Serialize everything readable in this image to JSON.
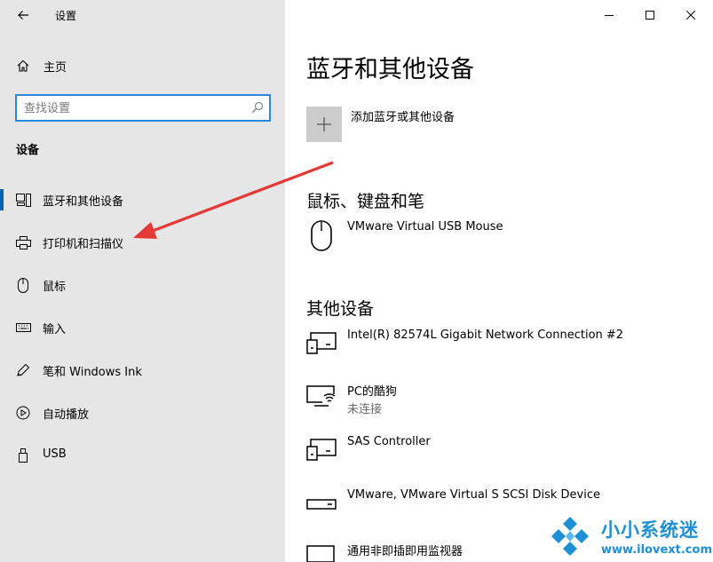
{
  "window": {
    "title": "设置"
  },
  "sidebar": {
    "home_label": "主页",
    "search_placeholder": "查找设置",
    "section_title": "设备",
    "items": [
      {
        "label": "蓝牙和其他设备",
        "icon": "bluetooth-devices-icon",
        "selected": true
      },
      {
        "label": "打印机和扫描仪",
        "icon": "printer-icon",
        "selected": false
      },
      {
        "label": "鼠标",
        "icon": "mouse-icon",
        "selected": false
      },
      {
        "label": "输入",
        "icon": "keyboard-icon",
        "selected": false
      },
      {
        "label": "笔和 Windows Ink",
        "icon": "pen-icon",
        "selected": false
      },
      {
        "label": "自动播放",
        "icon": "autoplay-icon",
        "selected": false
      },
      {
        "label": "USB",
        "icon": "usb-icon",
        "selected": false
      }
    ]
  },
  "main": {
    "title": "蓝牙和其他设备",
    "add_label": "添加蓝牙或其他设备",
    "mouse_section": {
      "title": "鼠标、键盘和笔",
      "devices": [
        {
          "name": "VMware Virtual USB Mouse",
          "icon": "mouse-icon"
        }
      ]
    },
    "other_section": {
      "title": "其他设备",
      "devices": [
        {
          "name": "Intel(R) 82574L Gigabit Network Connection #2",
          "status": "",
          "icon": "network-adapter-icon"
        },
        {
          "name": "PC的酷狗",
          "status": "未连接",
          "icon": "wireless-display-icon"
        },
        {
          "name": "SAS Controller",
          "status": "",
          "icon": "controller-icon"
        },
        {
          "name": "VMware, VMware Virtual S SCSI Disk Device",
          "status": "",
          "icon": "disk-drive-icon"
        },
        {
          "name": "通用非即插即用监视器",
          "status": "",
          "icon": "monitor-icon"
        }
      ]
    }
  },
  "watermark": {
    "name": "小小系统迷",
    "url": "www.ilovext.com"
  },
  "colors": {
    "accent": "#0063b1",
    "sidebar_bg": "#e6e6e6",
    "arrow": "#e53935",
    "watermark": "#1e90d6"
  }
}
